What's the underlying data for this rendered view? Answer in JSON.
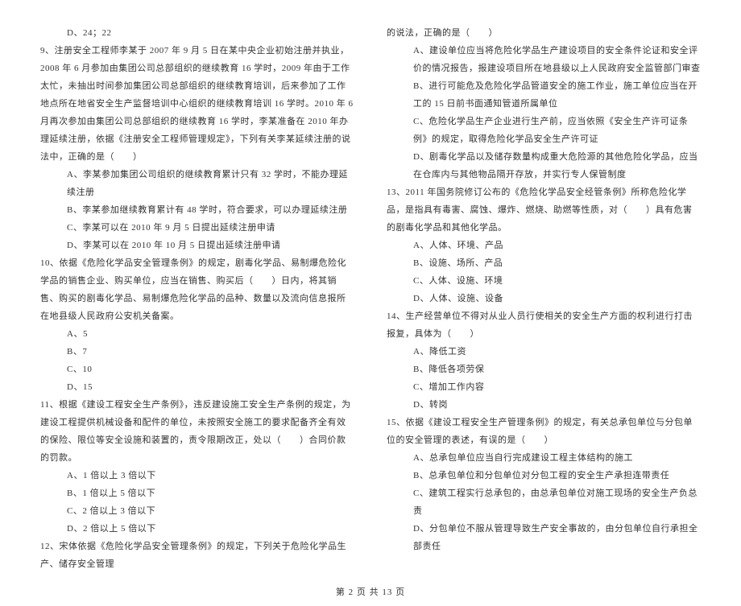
{
  "left": {
    "q8d": "D、24；22",
    "q9_stem": "9、注册安全工程师李某于 2007 年 9 月 5 日在某中央企业初始注册并执业，2008 年 6 月参加由集团公司总部组织的继续教育 16 学时，2009 年由于工作太忙，未抽出时间参加集团公司总部组织的继续教育培训，后来参加了工作地点所在地省安全生产监督培训中心组织的继续教育培训 16 学时。2010 年 6 月再次参加由集团公司总部组织的继续教育 16 学时，李某准备在 2010 年办理延续注册，依据《注册安全工程师管理规定》，下列有关李某延续注册的说法中，正确的是（　　）",
    "q9a": "A、李某参加集团公司组织的继续教育累计只有 32 学时，不能办理延续注册",
    "q9b": "B、李某参加继续教育累计有 48 学时，符合要求，可以办理延续注册",
    "q9c": "C、李某可以在 2010 年 9 月 5 日提出延续注册申请",
    "q9d": "D、李某可以在 2010 年 10 月 5 日提出延续注册申请",
    "q10_stem": "10、依据《危险化学品安全管理条例》的规定，剧毒化学品、易制爆危险化学品的销售企业、购买单位，应当在销售、购买后（　　）日内，将其销售、购买的剧毒化学品、易制爆危险化学品的品种、数量以及流向信息报所在地县级人民政府公安机关备案。",
    "q10a": "A、5",
    "q10b": "B、7",
    "q10c": "C、10",
    "q10d": "D、15",
    "q11_stem": "11、根据《建设工程安全生产条例》，违反建设施工安全生产条例的规定，为建设工程提供机械设备和配件的单位，未按照安全施工的要求配备齐全有效的保险、限位等安全设施和装置的，责令限期改正，处以（　　）合同价款的罚款。",
    "q11a": "A、1 倍以上 3 倍以下",
    "q11b": "B、1 倍以上 5 倍以下",
    "q11c": "C、2 倍以上 3 倍以下",
    "q11d": "D、2 倍以上 5 倍以下",
    "q12_stem": "12、宋体依据《危险化学品安全管理条例》的规定，下列关于危险化学品生产、储存安全管理"
  },
  "right": {
    "q12_cont": "的说法，正确的是（　　）",
    "q12a": "A、建设单位应当将危险化学品生产建设项目的安全条件论证和安全评价的情况报告，报建设项目所在地县级以上人民政府安全监管部门审查",
    "q12b": "B、进行可能危及危险化学品管道安全的施工作业，施工单位应当在开工的 15 日前书面通知管道所属单位",
    "q12c": "C、危险化学品生产企业进行生产前，应当依照《安全生产许可证条例》的规定，取得危险化学品安全生产许可证",
    "q12d": "D、剧毒化学品以及储存数量构成重大危险源的其他危险化学品，应当在仓库内与其他物品隔开存放，并实行专人保管制度",
    "q13_stem": "13、2011 年国务院修订公布的《危险化学品安全经管条例》所称危险化学品，是指具有毒害、腐蚀、爆炸、燃烧、助燃等性质，对（　　）具有危害的剧毒化学品和其他化学品。",
    "q13a": "A、人体、环境、产品",
    "q13b": "B、设施、场所、产品",
    "q13c": "C、人体、设施、环境",
    "q13d": "D、人体、设施、设备",
    "q14_stem": "14、生产经营单位不得对从业人员行使相关的安全生产方面的权利进行打击报复，具体为（　　）",
    "q14a": "A、降低工资",
    "q14b": "B、降低各项劳保",
    "q14c": "C、增加工作内容",
    "q14d": "D、转岗",
    "q15_stem": "15、依据《建设工程安全生产管理条例》的规定，有关总承包单位与分包单位的安全管理的表述，有误的是（　　）",
    "q15a": "A、总承包单位应当自行完成建设工程主体结构的施工",
    "q15b": "B、总承包单位和分包单位对分包工程的安全生产承担连带责任",
    "q15c": "C、建筑工程实行总承包的，由总承包单位对施工现场的安全生产负总责",
    "q15d": "D、分包单位不服从管理导致生产安全事故的，由分包单位自行承担全部责任"
  },
  "footer": "第 2 页 共 13 页"
}
